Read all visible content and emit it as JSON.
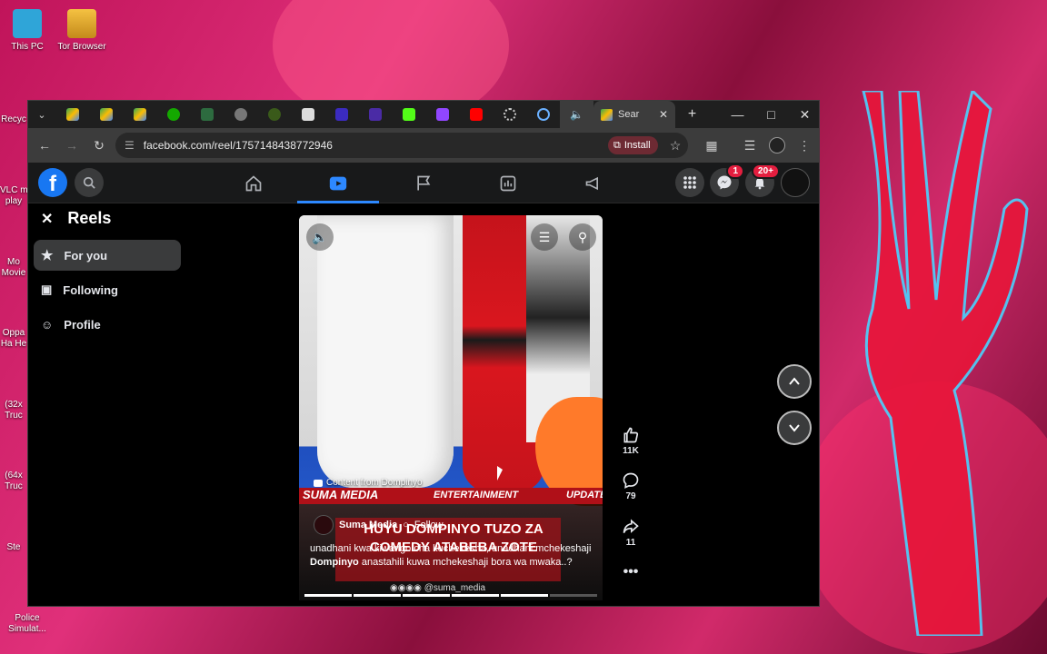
{
  "desktop": {
    "icons": [
      {
        "label": "This PC"
      },
      {
        "label": "Tor Browser"
      }
    ],
    "left_strip": [
      {
        "label": "Recyc"
      },
      {
        "label": "VLC m\nplay"
      },
      {
        "label": "Mo\nMovie"
      },
      {
        "label": "Oppa\nHa He"
      },
      {
        "label": "(32x\nTruc"
      },
      {
        "label": "(64x\nTruc"
      },
      {
        "label": "Ste"
      },
      {
        "label": "Police\nSimulat..."
      }
    ]
  },
  "browser": {
    "active_tab": {
      "title": "Sear"
    },
    "url": "facebook.com/reel/1757148438772946",
    "install_label": "Install"
  },
  "facebook": {
    "notifications_badge": "20+",
    "messenger_badge": "1"
  },
  "reels": {
    "title": "Reels",
    "menu": [
      {
        "label": "For you",
        "active": true
      },
      {
        "label": "Following",
        "active": false
      },
      {
        "label": "Profile",
        "active": false
      }
    ]
  },
  "video": {
    "content_from": "Content from Dompinyo",
    "banner_left": "SUMA MEDIA",
    "banner_mid": "ENTERTAINMENT",
    "banner_right": "UPDATE",
    "headline": "HUYU DOMPINYO TUZO ZA COMEDY ATABEBA ZOTE",
    "author": "Suma Media",
    "follow_label": "Follow",
    "caption_pre": "unadhani kwa kiwango cha kuchekesha, unadhani mchekeshaji ",
    "caption_bold": "Dompinyo",
    "caption_post": " anastahili kuwa mchekeshaji bora wa mwaka..?",
    "handle": "@suma_media"
  },
  "actions": {
    "likes": "11K",
    "comments": "79",
    "shares": "11"
  }
}
